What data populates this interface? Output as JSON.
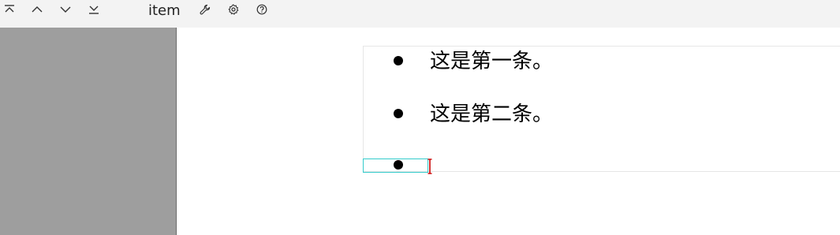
{
  "toolbar": {
    "search_term": "item",
    "buttons": [
      {
        "name": "first-result-button",
        "icon": "chevron-up-bar-icon"
      },
      {
        "name": "previous-result-button",
        "icon": "chevron-up-icon"
      },
      {
        "name": "next-result-button",
        "icon": "chevron-down-icon"
      },
      {
        "name": "last-result-button",
        "icon": "chevron-down-bar-icon"
      },
      {
        "name": "tools-button",
        "icon": "wrench-icon"
      },
      {
        "name": "settings-button",
        "icon": "gear-icon"
      },
      {
        "name": "help-button",
        "icon": "help-icon"
      }
    ]
  },
  "document": {
    "list_items": [
      {
        "text": "这是第一条。"
      },
      {
        "text": "这是第二条。"
      },
      {
        "text": ""
      }
    ]
  },
  "colors": {
    "toolbar_bg": "#f3f3f3",
    "sidebar_bg": "#9e9e9e",
    "highlight_border": "#33cccc",
    "cursor": "#cc0000"
  }
}
